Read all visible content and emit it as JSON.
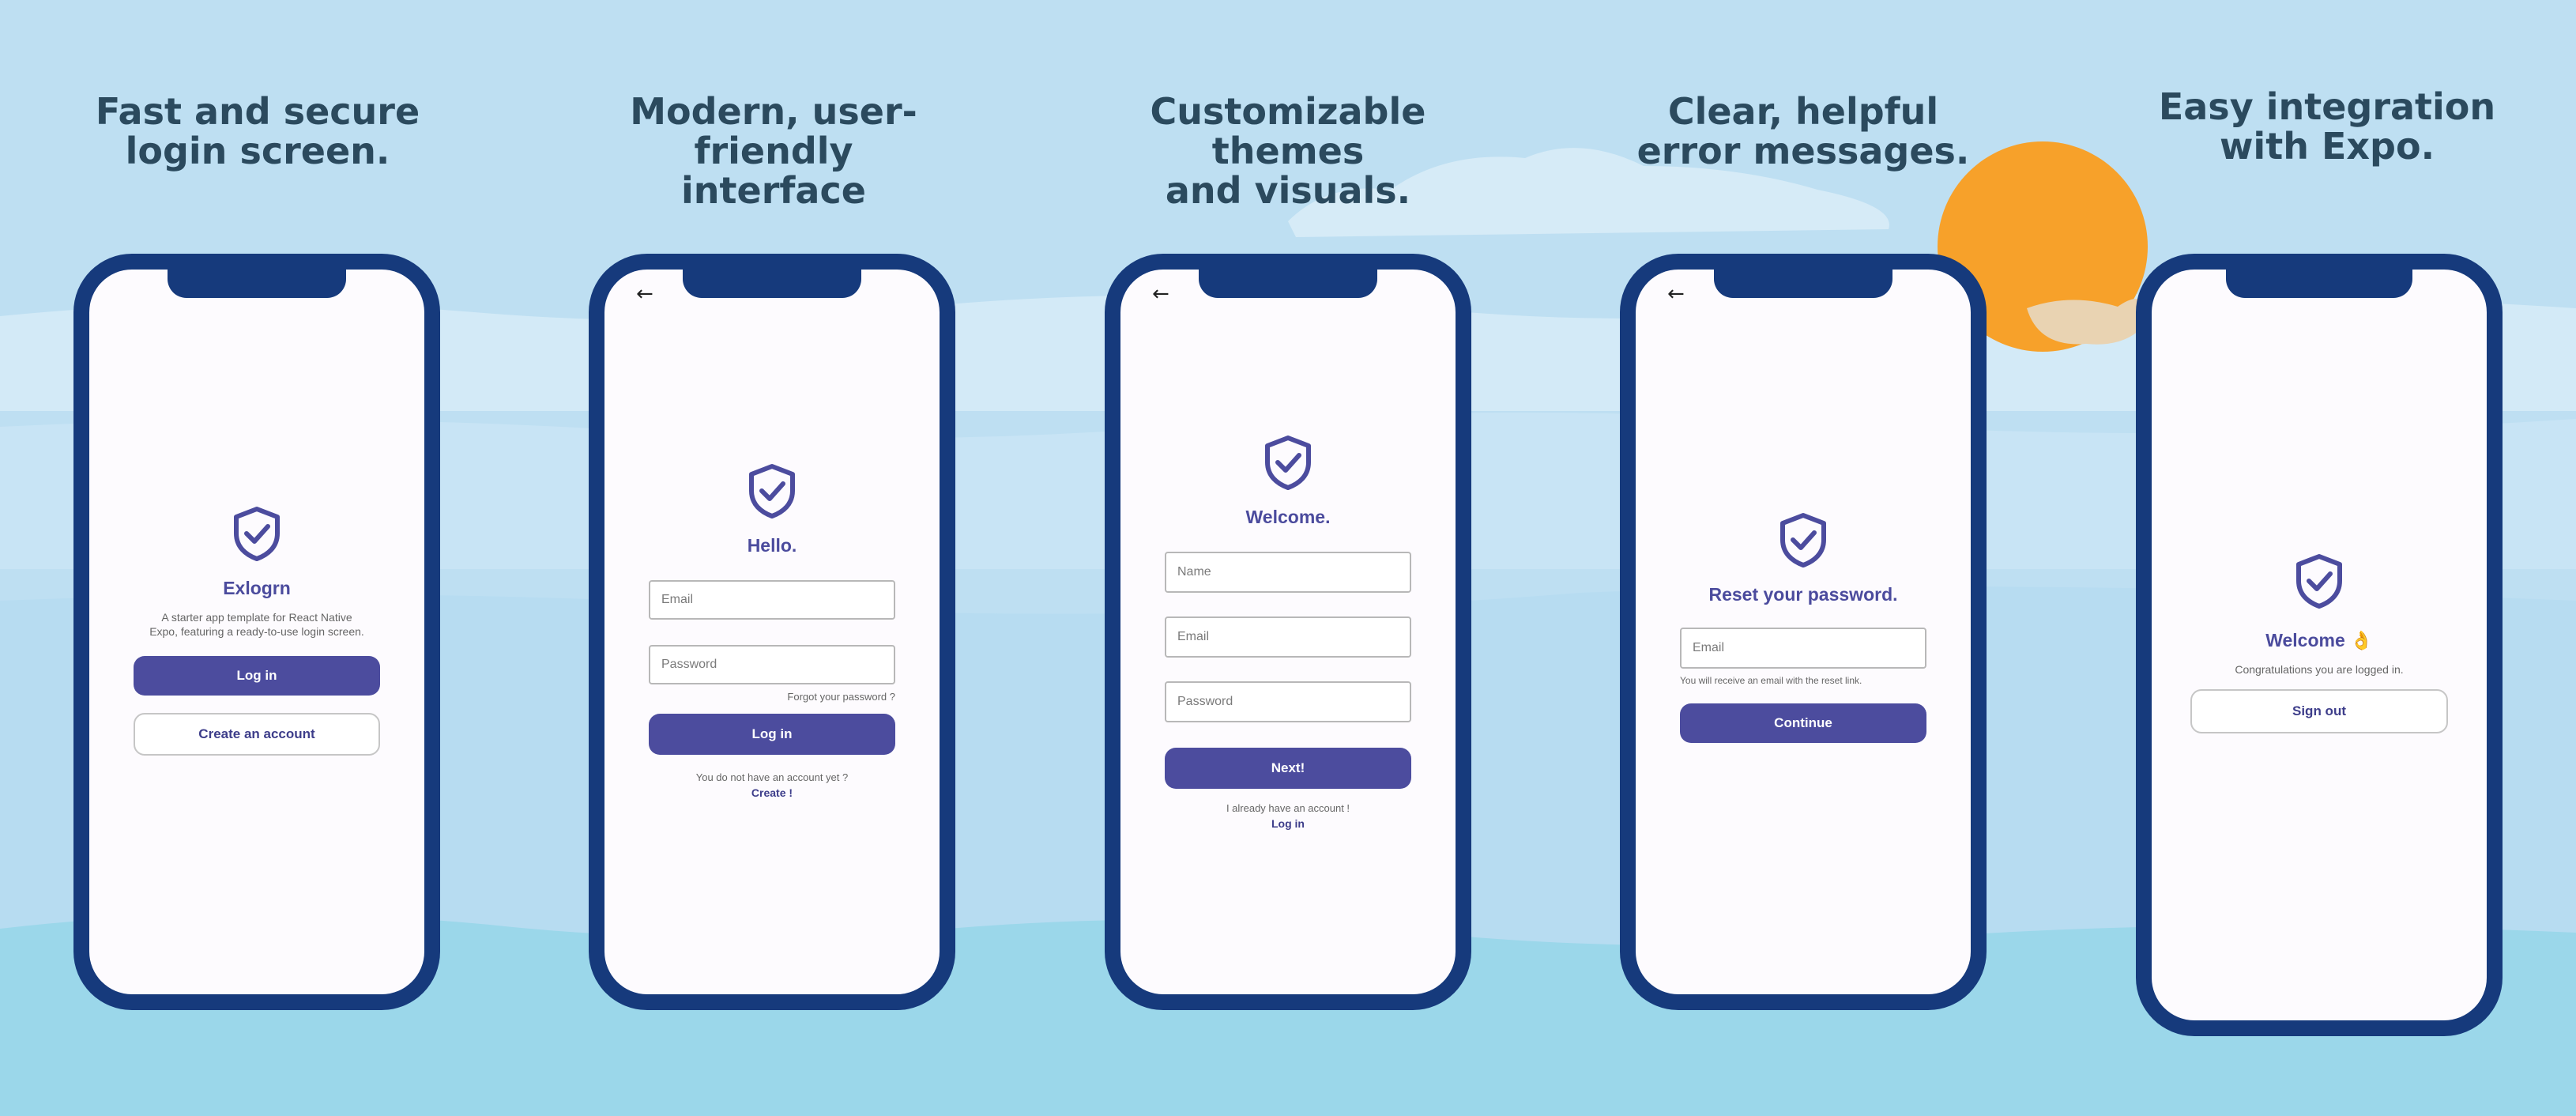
{
  "captions": [
    {
      "line1": "Fast and secure",
      "line2": "login screen."
    },
    {
      "line1": "Modern, user-friendly",
      "line2": "interface"
    },
    {
      "line1": "Customizable themes",
      "line2": "and visuals."
    },
    {
      "line1": "Clear, helpful",
      "line2": "error messages."
    },
    {
      "line1": "Easy integration",
      "line2": "with Expo."
    }
  ],
  "colors": {
    "phone_frame": "#163a7c",
    "accent": "#4c4c9e",
    "screen_bg": "#fdfbfe",
    "sky": "#bedff2",
    "sun": "#f7a12a"
  },
  "icons": {
    "back": "arrow-left-icon",
    "logo": "shield-check-icon"
  },
  "screen1": {
    "title": "Exlogrn",
    "desc_line1": "A starter app template for React Native",
    "desc_line2": "Expo, featuring a ready-to-use login screen.",
    "login_label": "Log in",
    "create_label": "Create an account"
  },
  "screen2": {
    "title": "Hello.",
    "email_placeholder": "Email",
    "password_placeholder": "Password",
    "forgot_link": "Forgot your password ?",
    "login_label": "Log in",
    "no_account_text": "You do not have an account yet ?",
    "create_link": "Create !"
  },
  "screen3": {
    "title": "Welcome.",
    "name_placeholder": "Name",
    "email_placeholder": "Email",
    "password_placeholder": "Password",
    "next_label": "Next!",
    "have_account_text": "I already have an account !",
    "login_link": "Log in"
  },
  "screen4": {
    "title": "Reset your password.",
    "email_placeholder": "Email",
    "helper_text": "You will receive an email with the reset link.",
    "continue_label": "Continue"
  },
  "screen5": {
    "title": "Welcome 👌",
    "message": "Congratulations you are logged in.",
    "signout_label": "Sign out"
  }
}
